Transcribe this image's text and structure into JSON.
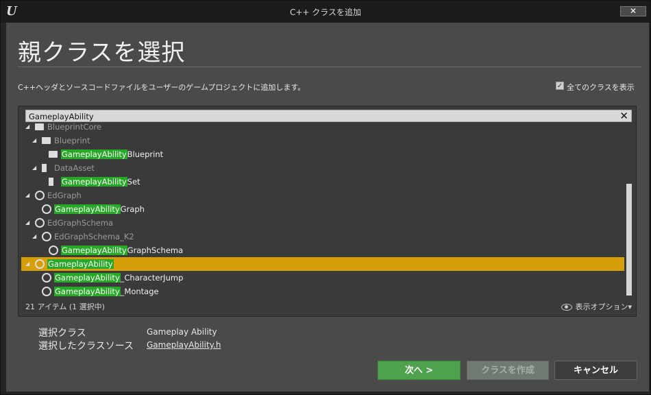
{
  "window": {
    "title": "C++ クラスを追加",
    "close_label": "✕",
    "logo": "U"
  },
  "heading": "親クラスを選択",
  "description": "C++ヘッダとソースコードファイルをユーザーのゲームプロジェクトに追加します。",
  "show_all": {
    "label": "全てのクラスを表示",
    "checked": true,
    "check_glyph": "✓"
  },
  "search": {
    "value": "GameplayAbility",
    "clear_label": "✕"
  },
  "tree": {
    "rows": [
      {
        "pre": "",
        "match": "",
        "post": "BlueprintCore",
        "icon": "book-icon",
        "dim": true
      },
      {
        "pre": "",
        "match": "",
        "post": "Blueprint",
        "icon": "book-icon",
        "dim": true
      },
      {
        "pre": "",
        "match": "GameplayAbility",
        "post": "Blueprint",
        "icon": "book-icon",
        "dim": false
      },
      {
        "pre": "",
        "match": "",
        "post": "DataAsset",
        "icon": "data-asset-icon",
        "dim": true
      },
      {
        "pre": "",
        "match": "GameplayAbility",
        "post": "Set",
        "icon": "data-asset-icon",
        "dim": false
      },
      {
        "pre": "",
        "match": "",
        "post": "EdGraph",
        "icon": "class-circle-icon",
        "dim": true
      },
      {
        "pre": "",
        "match": "GameplayAbility",
        "post": "Graph",
        "icon": "class-circle-icon",
        "dim": false
      },
      {
        "pre": "",
        "match": "",
        "post": "EdGraphSchema",
        "icon": "class-circle-icon",
        "dim": true
      },
      {
        "pre": "",
        "match": "",
        "post": "EdGraphSchema_K2",
        "icon": "class-circle-icon",
        "dim": true
      },
      {
        "pre": "",
        "match": "GameplayAbility",
        "post": "GraphSchema",
        "icon": "class-circle-icon",
        "dim": false
      },
      {
        "pre": "",
        "match": "GameplayAbility",
        "post": "",
        "icon": "class-circle-icon",
        "dim": false,
        "selected": true
      },
      {
        "pre": "",
        "match": "GameplayAbility",
        "post": "_CharacterJump",
        "icon": "class-circle-icon",
        "dim": false
      },
      {
        "pre": "",
        "match": "GameplayAbility",
        "post": "_Montage",
        "icon": "class-circle-icon",
        "dim": false
      }
    ],
    "count_text": "21 アイテム (1 選択中)",
    "view_options": "表示オプション▾"
  },
  "info": {
    "selected_class_label": "選択クラス",
    "selected_class_value": "Gameplay Ability",
    "selected_source_label": "選択したクラスソース",
    "selected_source_value": "GameplayAbility.h"
  },
  "buttons": {
    "next": "次へ >",
    "create": "クラスを作成",
    "cancel": "キャンセル"
  },
  "colors": {
    "selected_row": "#d69e08",
    "match_highlight": "#27a827",
    "next_button": "#4ea24e"
  }
}
